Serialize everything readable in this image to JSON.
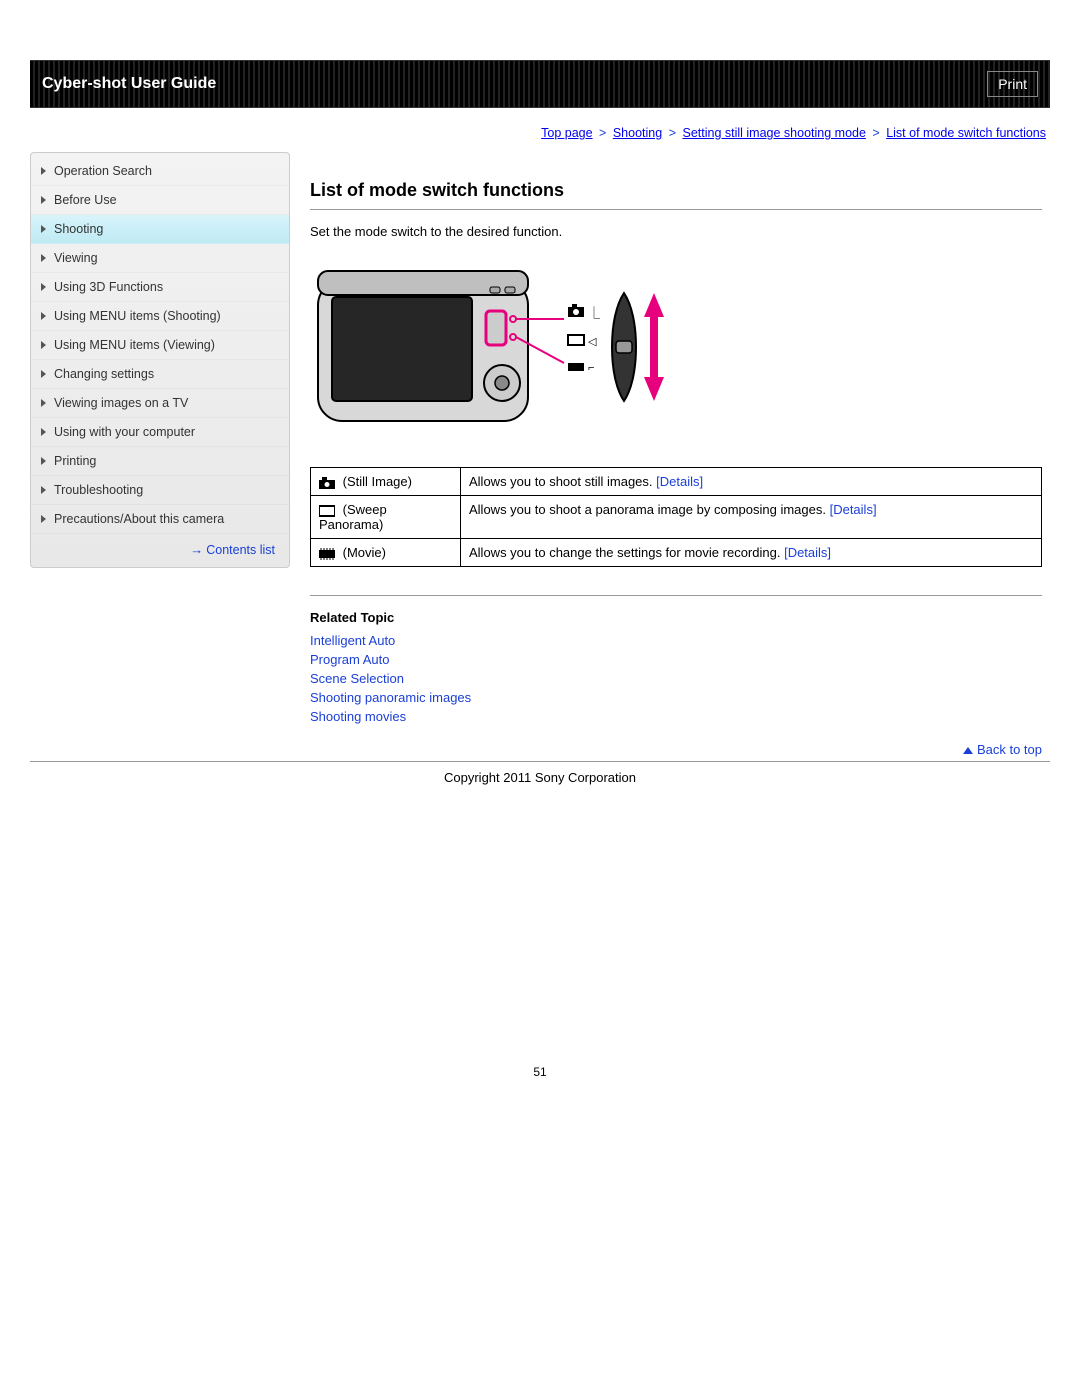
{
  "header": {
    "title": "Cyber-shot User Guide",
    "print_label": "Print"
  },
  "breadcrumb": {
    "items": [
      "Top page",
      "Shooting",
      "Setting still image shooting mode",
      "List of mode switch functions"
    ]
  },
  "sidebar": {
    "items": [
      {
        "label": "Operation Search",
        "active": false
      },
      {
        "label": "Before Use",
        "active": false
      },
      {
        "label": "Shooting",
        "active": true
      },
      {
        "label": "Viewing",
        "active": false
      },
      {
        "label": "Using 3D Functions",
        "active": false
      },
      {
        "label": "Using MENU items (Shooting)",
        "active": false
      },
      {
        "label": "Using MENU items (Viewing)",
        "active": false
      },
      {
        "label": "Changing settings",
        "active": false
      },
      {
        "label": "Viewing images on a TV",
        "active": false
      },
      {
        "label": "Using with your computer",
        "active": false
      },
      {
        "label": "Printing",
        "active": false
      },
      {
        "label": "Troubleshooting",
        "active": false
      },
      {
        "label": "Precautions/About this camera",
        "active": false
      }
    ],
    "contents_list": "Contents list"
  },
  "main": {
    "title": "List of mode switch functions",
    "intro": "Set the mode switch to the desired function.",
    "table": {
      "rows": [
        {
          "icon": "camera-icon",
          "name": "(Still Image)",
          "desc": "Allows you to shoot still images.",
          "details": "[Details]"
        },
        {
          "icon": "panorama-icon",
          "name": "(Sweep Panorama)",
          "desc": "Allows you to shoot a panorama image by composing images.",
          "details": "[Details]"
        },
        {
          "icon": "movie-icon",
          "name": "(Movie)",
          "desc": "Allows you to change the settings for movie recording.",
          "details": "[Details]"
        }
      ]
    },
    "related": {
      "heading": "Related Topic",
      "links": [
        "Intelligent Auto",
        "Program Auto",
        "Scene Selection",
        "Shooting panoramic images",
        "Shooting movies"
      ]
    },
    "back_to_top": "Back to top"
  },
  "footer": {
    "copyright": "Copyright 2011 Sony Corporation",
    "page_number": "51"
  }
}
